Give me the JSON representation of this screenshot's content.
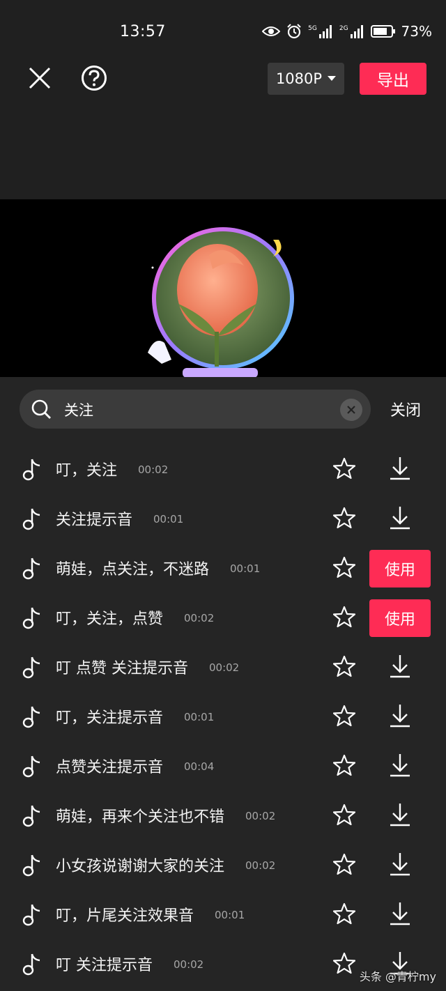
{
  "status_bar": {
    "time": "13:57",
    "network_1": "5G",
    "network_2": "2G",
    "battery": "73%",
    "icons": [
      "eye-icon",
      "alarm-icon",
      "signal-icon",
      "signal-icon",
      "battery-icon"
    ]
  },
  "toolbar": {
    "close_icon": "close-icon",
    "help_icon": "help-icon",
    "resolution": "1080P",
    "export_label": "导出"
  },
  "search": {
    "query": "关注",
    "close_label": "关闭"
  },
  "sounds": [
    {
      "title": "叮，关注",
      "duration": "00:02",
      "action": "download"
    },
    {
      "title": " 关注提示音",
      "duration": "00:01",
      "action": "download"
    },
    {
      "title": "萌娃，点关注，不迷路",
      "duration": "00:01",
      "action": "use",
      "action_label": "使用"
    },
    {
      "title": "叮，关注，点赞",
      "duration": "00:02",
      "action": "use",
      "action_label": "使用"
    },
    {
      "title": "叮 点赞 关注提示音",
      "duration": "00:02",
      "action": "download"
    },
    {
      "title": "叮，关注提示音",
      "duration": "00:01",
      "action": "download"
    },
    {
      "title": "点赞关注提示音",
      "duration": "00:04",
      "action": "download"
    },
    {
      "title": "萌娃，再来个关注也不错",
      "duration": "00:02",
      "action": "download"
    },
    {
      "title": "小女孩说谢谢大家的关注",
      "duration": "00:02",
      "action": "download"
    },
    {
      "title": "叮，片尾关注效果音",
      "duration": "00:01",
      "action": "download"
    },
    {
      "title": "叮 关注提示音",
      "duration": "00:02",
      "action": "download"
    }
  ],
  "watermark": "头条 @青柠my",
  "colors": {
    "accent": "#fe2c55",
    "background": "#202020",
    "sheet": "#252525"
  }
}
